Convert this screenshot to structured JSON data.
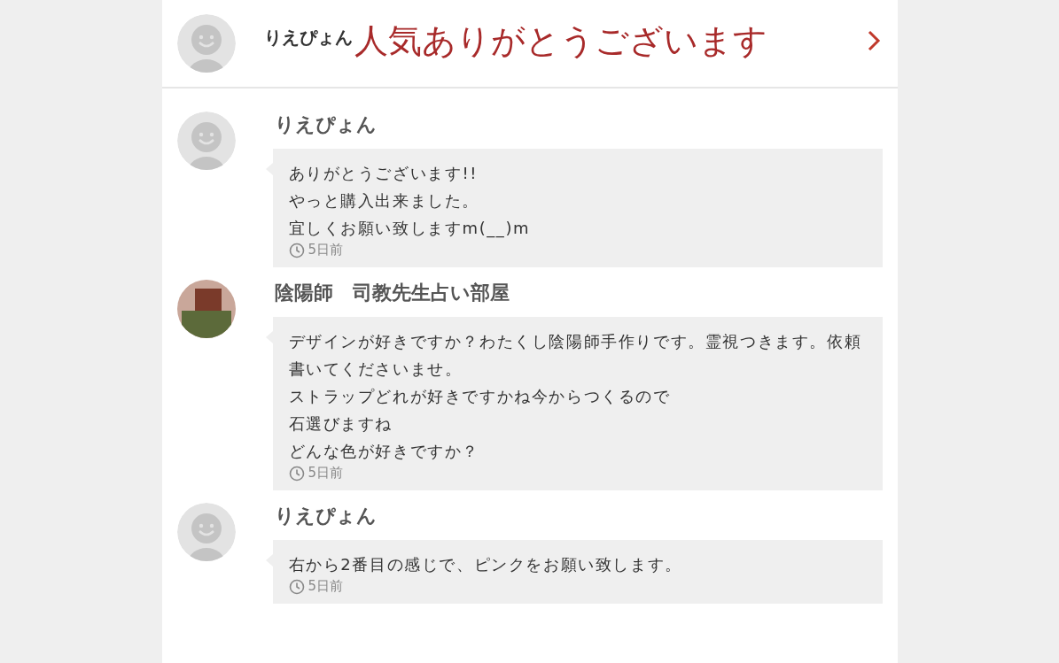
{
  "header": {
    "name": "りえぴょん",
    "overlay": "人気ありがとうございます"
  },
  "comments": [
    {
      "name": "りえぴょん",
      "kind": "default",
      "lines": [
        "ありがとうございます!!",
        "やっと購入出来ました。",
        "宜しくお願い致しますm(__)m"
      ],
      "time": "5日前"
    },
    {
      "name": "陰陽師　司教先生占い部屋",
      "kind": "photo",
      "lines": [
        "デザインが好きですか？わたくし陰陽師手作りです。霊視つきます。依頼書いてくださいませ。",
        "ストラップどれが好きですかね今からつくるので",
        "石選びますね",
        "どんな色が好きですか？"
      ],
      "time": "5日前"
    },
    {
      "name": "りえぴょん",
      "kind": "default",
      "lines": [
        "右から2番目の感じで、ピンクをお願い致します。"
      ],
      "time": "5日前"
    }
  ]
}
